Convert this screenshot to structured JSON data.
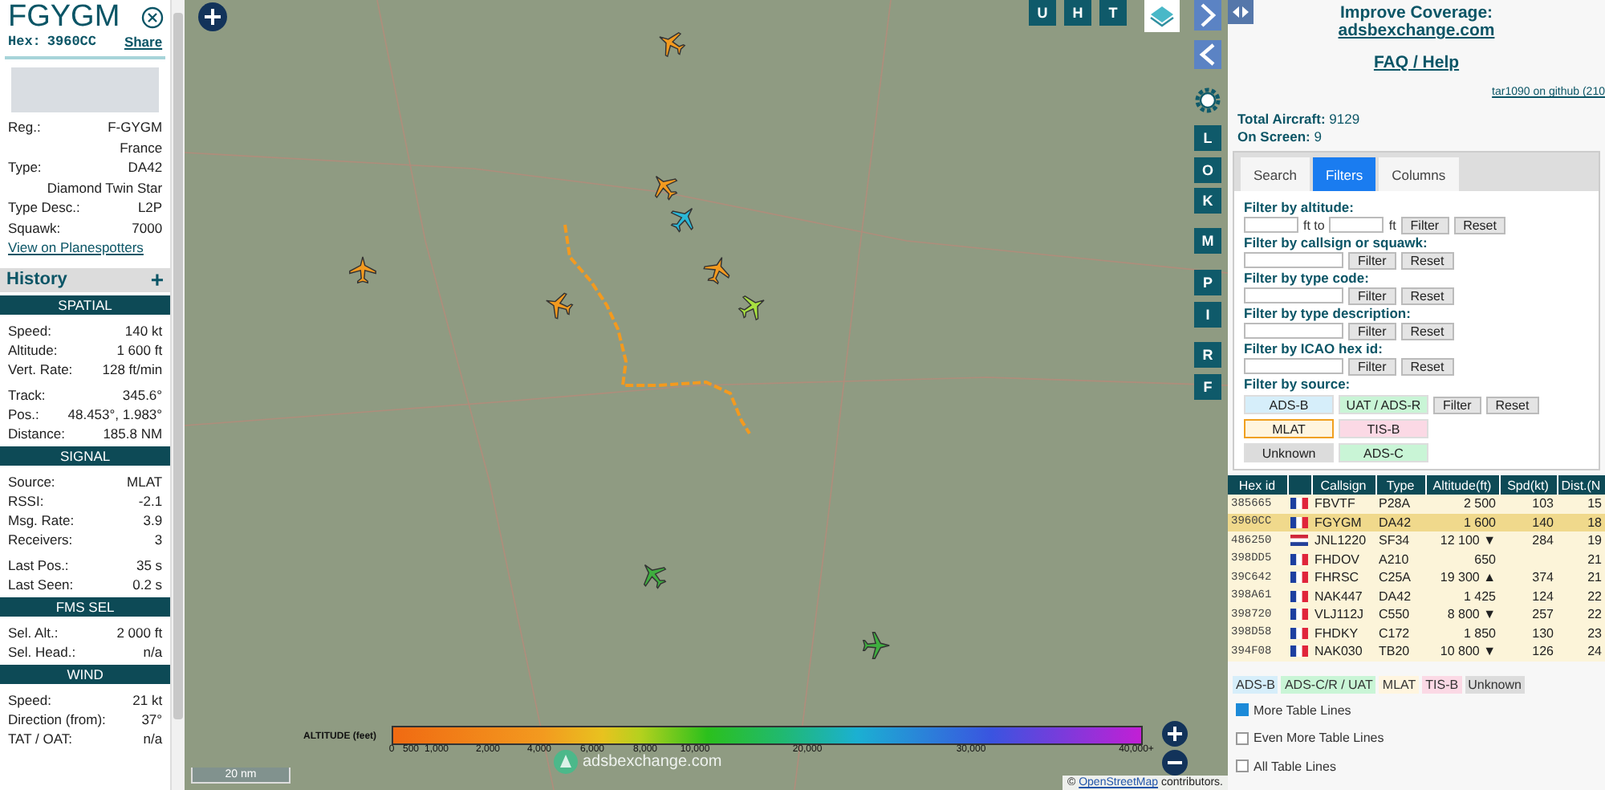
{
  "selected_aircraft": {
    "callsign": "FGYGM",
    "hex_label": "Hex:",
    "hex": "3960CC",
    "share": "Share",
    "info": [
      {
        "label": "Reg.:",
        "value": "F-GYGM"
      },
      {
        "value": "France"
      },
      {
        "label": "Type:",
        "value": "DA42"
      },
      {
        "value": "Diamond Twin Star"
      },
      {
        "label": "Type Desc.:",
        "value": "L2P"
      },
      {
        "label": "Squawk:",
        "value": "7000"
      }
    ],
    "planespotters_link": "View on Planespotters"
  },
  "history": {
    "title": "History",
    "toggle": "+"
  },
  "sections": [
    {
      "title": "SPATIAL",
      "groups": [
        [
          {
            "label": "Speed:",
            "value": "140 kt"
          },
          {
            "label": "Altitude:",
            "value": "1 600 ft"
          },
          {
            "label": "Vert. Rate:",
            "value": "128 ft/min"
          }
        ],
        [
          {
            "label": "Track:",
            "value": "345.6°"
          },
          {
            "label": "Pos.:",
            "value": "48.453°, 1.983°"
          },
          {
            "label": "Distance:",
            "value": "185.8 NM"
          }
        ]
      ]
    },
    {
      "title": "SIGNAL",
      "groups": [
        [
          {
            "label": "Source:",
            "value": "MLAT"
          },
          {
            "label": "RSSI:",
            "value": "-2.1"
          },
          {
            "label": "Msg. Rate:",
            "value": "3.9"
          },
          {
            "label": "Receivers:",
            "value": "3"
          }
        ],
        [
          {
            "label": "Last Pos.:",
            "value": "35 s"
          },
          {
            "label": "Last Seen:",
            "value": "0.2 s"
          }
        ]
      ]
    },
    {
      "title": "FMS SEL",
      "groups": [
        [
          {
            "label": "Sel. Alt.:",
            "value": "2 000 ft"
          },
          {
            "label": "Sel. Head.:",
            "value": "n/a"
          }
        ]
      ]
    },
    {
      "title": "WIND",
      "groups": [
        [
          {
            "label": "Speed:",
            "value": "21 kt"
          },
          {
            "label": "Direction (from):",
            "value": "37°"
          },
          {
            "label": "TAT / OAT:",
            "value": "n/a"
          }
        ]
      ]
    }
  ],
  "map": {
    "top_buttons": [
      "U",
      "H",
      "T"
    ],
    "side_buttons": [
      "L",
      "O",
      "K",
      "M",
      "P",
      "I",
      "R",
      "F"
    ],
    "aircraft": [
      {
        "color": "#f39a1f"
      },
      {
        "color": "#f39a1f"
      },
      {
        "color": "#2ab8d8"
      },
      {
        "color": "#f39a1f"
      },
      {
        "color": "#f39a1f"
      },
      {
        "color": "#f39a1f"
      },
      {
        "color": "#a8e040"
      },
      {
        "color": "#3fae3f"
      },
      {
        "color": "#3fae3f"
      }
    ],
    "altitude_legend": {
      "title": "ALTITUDE (feet)",
      "ticks": [
        "0",
        "500",
        "1,000",
        "2,000",
        "4,000",
        "6,000",
        "8,000",
        "10,000",
        "20,000",
        "30,000",
        "40,000+"
      ]
    },
    "scale": "20 nm",
    "logo_text": "adsbexchange.com",
    "attribution": {
      "prefix": "©",
      "link": "OpenStreetMap",
      "suffix": "contributors."
    }
  },
  "right_panel": {
    "improve_title": "Improve Coverage:",
    "improve_link": "adsbexchange.com",
    "faq_link": "FAQ / Help",
    "version_link": "tar1090 on github (210",
    "stats": [
      {
        "label": "Total Aircraft:",
        "value": "9129"
      },
      {
        "label": "On Screen:",
        "value": "9"
      }
    ],
    "tabs": [
      {
        "label": "Search",
        "selected": false
      },
      {
        "label": "Filters",
        "selected": true
      },
      {
        "label": "Columns",
        "selected": false
      }
    ],
    "filters": [
      {
        "label": "Filter by altitude:",
        "kind": "range",
        "between": "ft to",
        "unit": "ft",
        "buttons": [
          "Filter",
          "Reset"
        ]
      },
      {
        "label": "Filter by callsign or squawk:",
        "kind": "text",
        "buttons": [
          "Filter",
          "Reset"
        ]
      },
      {
        "label": "Filter by type code:",
        "kind": "text",
        "buttons": [
          "Filter",
          "Reset"
        ]
      },
      {
        "label": "Filter by type description:",
        "kind": "text",
        "buttons": [
          "Filter",
          "Reset"
        ]
      },
      {
        "label": "Filter by ICAO hex id:",
        "kind": "text",
        "buttons": [
          "Filter",
          "Reset"
        ]
      }
    ],
    "source_filter": {
      "label": "Filter by source:",
      "buttons": [
        "Filter",
        "Reset"
      ],
      "sources": [
        {
          "label": "ADS-B",
          "color": "#d6eefa",
          "selected": false
        },
        {
          "label": "UAT / ADS-R",
          "color": "#c9f5d6",
          "selected": false
        },
        {
          "label": "MLAT",
          "color": "#fff5df",
          "selected": true
        },
        {
          "label": "TIS-B",
          "color": "#fbd9e5",
          "selected": false
        },
        {
          "label": "Unknown",
          "color": "#dcdcdc",
          "selected": false
        },
        {
          "label": "ADS-C",
          "color": "#c9f5d6",
          "selected": false
        }
      ]
    }
  },
  "aircraft_table": {
    "columns": [
      "Hex id",
      "Callsign",
      "Type",
      "Altitude(ft)",
      "Spd(kt)",
      "Dist.(N"
    ],
    "rows": [
      {
        "hex": "385665",
        "kind": "france",
        "callsign": "FBVTF",
        "type": "P28A",
        "altitude": "2 500",
        "speed": "103",
        "distance": "15",
        "selected": false
      },
      {
        "hex": "3960CC",
        "kind": "france",
        "callsign": "FGYGM",
        "type": "DA42",
        "altitude": "1 600",
        "speed": "140",
        "distance": "18",
        "selected": true
      },
      {
        "hex": "486250",
        "kind": "netherlands",
        "callsign": "JNL1220",
        "type": "SF34",
        "altitude": "12 100 ▼",
        "speed": "284",
        "distance": "19",
        "selected": false
      },
      {
        "hex": "398DD5",
        "kind": "france",
        "callsign": "FHDOV",
        "type": "A210",
        "altitude": "650",
        "distance": "21",
        "selected": false
      },
      {
        "hex": "39C642",
        "kind": "france",
        "callsign": "FHRSC",
        "type": "C25A",
        "altitude": "19 300 ▲",
        "speed": "374",
        "distance": "21",
        "selected": false
      },
      {
        "hex": "398A61",
        "kind": "france",
        "callsign": "NAK447",
        "type": "DA42",
        "altitude": "1 425",
        "speed": "124",
        "distance": "22",
        "selected": false
      },
      {
        "hex": "398720",
        "kind": "france",
        "callsign": "VLJ112J",
        "type": "C550",
        "altitude": "8 800 ▼",
        "speed": "257",
        "distance": "22",
        "selected": false
      },
      {
        "hex": "398D58",
        "kind": "france",
        "callsign": "FHDKY",
        "type": "C172",
        "altitude": "1 850",
        "speed": "130",
        "distance": "23",
        "selected": false
      },
      {
        "hex": "394F08",
        "kind": "france",
        "callsign": "NAK030",
        "type": "TB20",
        "altitude": "10 800 ▼",
        "speed": "126",
        "distance": "24",
        "selected": false
      }
    ]
  },
  "source_legend": [
    {
      "label": "ADS-B",
      "color": "#d6eefa"
    },
    {
      "label": "ADS-C/R / UAT",
      "color": "#c9f5d6"
    },
    {
      "label": "MLAT",
      "color": "#fff5df"
    },
    {
      "label": "TIS-B",
      "color": "#fbd9e5"
    },
    {
      "label": "Unknown",
      "color": "#dcdcdc"
    }
  ],
  "table_options": [
    {
      "label": "More Table Lines",
      "checked": true
    },
    {
      "label": "Even More Table Lines",
      "checked": false
    },
    {
      "label": "All Table Lines",
      "checked": false
    }
  ]
}
